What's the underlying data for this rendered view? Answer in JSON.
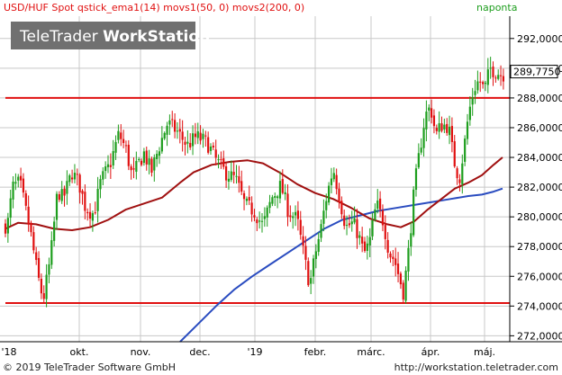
{
  "header": {
    "instrument": "USD/HUF Spot",
    "indicators": "qstick_ema1(14) movs1(50, 0) movs2(200, 0)",
    "period": "naponta"
  },
  "logo": {
    "part1": "TeleTrader",
    "part2": "WorkStation"
  },
  "price_box": "289,7750",
  "footer": {
    "copyright": "© 2019 TeleTrader Software GmbH",
    "url": "http://workstation.teletrader.com"
  },
  "colors": {
    "up_candle": "#1e9e1e",
    "down_candle": "#e01010",
    "ma50": "#a01010",
    "ma200": "#2a4cc0",
    "support_resistance": "#e01010",
    "grid": "#c8c8c8",
    "header_text": "#e01010",
    "period_text": "#1e9e1e"
  },
  "chart_data": {
    "type": "candlestick",
    "x_ticks": [
      "'18",
      "okt.",
      "nov.",
      "dec.",
      "'19",
      "febr.",
      "márc.",
      "ápr.",
      "máj."
    ],
    "y_ticks": [
      "272,0000",
      "274,0000",
      "276,0000",
      "278,0000",
      "280,0000",
      "282,0000",
      "284,0000",
      "286,0000",
      "288,0000",
      "290,0000",
      "292,0000"
    ],
    "ylim": [
      271.6,
      293.5
    ],
    "horizontal_lines": [
      288.0,
      274.2
    ],
    "last_price": 289.775,
    "grid": true,
    "series": [
      {
        "name": "movs1(50, 0)"
      },
      {
        "name": "movs2(200, 0)"
      }
    ]
  }
}
